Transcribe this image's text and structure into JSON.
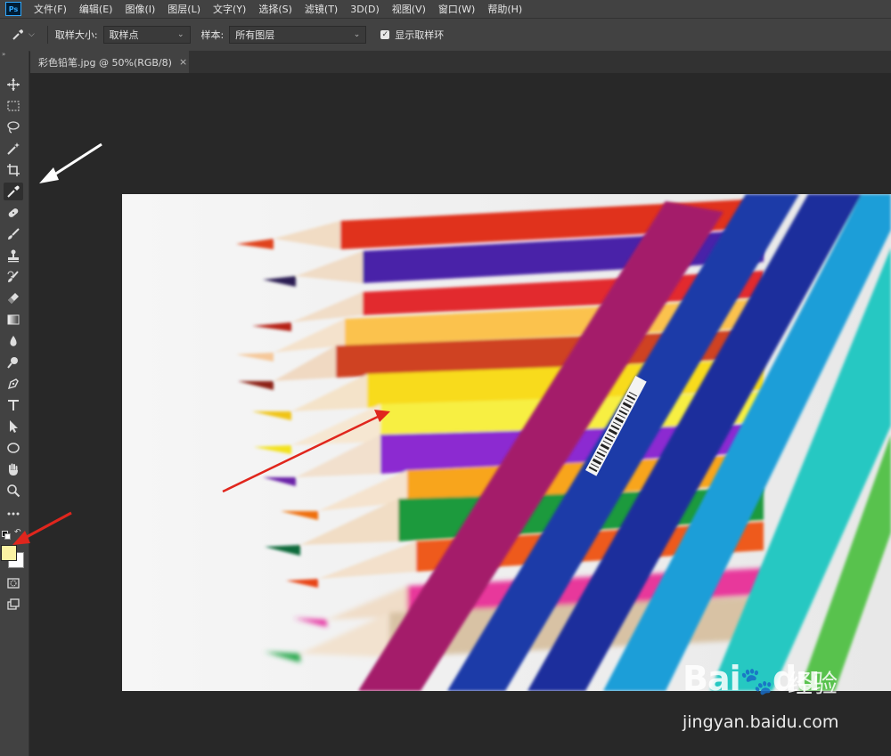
{
  "app": {
    "logo_text": "Ps"
  },
  "menu": [
    "文件(F)",
    "编辑(E)",
    "图像(I)",
    "图层(L)",
    "文字(Y)",
    "选择(S)",
    "滤镜(T)",
    "3D(D)",
    "视图(V)",
    "窗口(W)",
    "帮助(H)"
  ],
  "options": {
    "sample_size_label": "取样大小:",
    "sample_size_value": "取样点",
    "sample_label": "样本:",
    "sample_value": "所有图层",
    "show_ring_label": "显示取样环",
    "show_ring_checked": true
  },
  "document": {
    "tab_title": "彩色铅笔.jpg @ 50%(RGB/8)",
    "close_glyph": "×"
  },
  "colors": {
    "foreground": "#fbf3a3",
    "background": "#ffffff",
    "annotation_arrow": "#e0261d",
    "pointer_arrow": "#ffffff"
  },
  "watermark": {
    "logo": "Bai",
    "logo_suffix": "du",
    "brand_cn": "经验",
    "url": "jingyan.baidu.com"
  }
}
